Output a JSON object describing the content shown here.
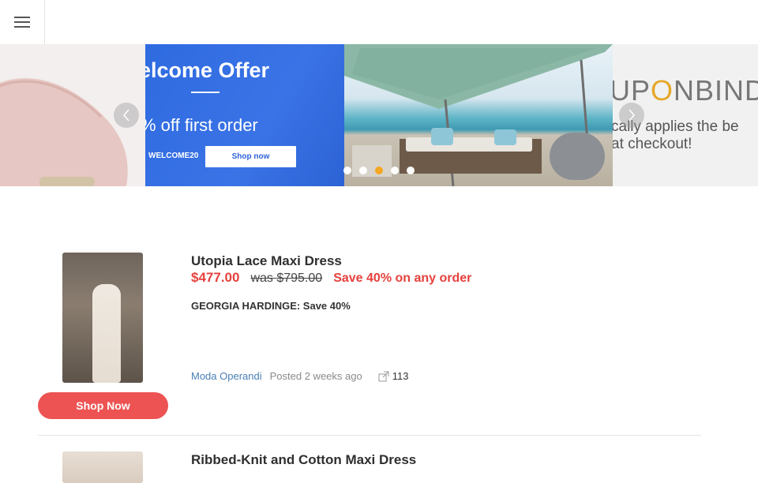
{
  "header": {
    "menu_icon": "hamburger-menu-icon"
  },
  "carousel": {
    "welcome": {
      "title": "elcome Offer",
      "subtitle": "% off first order",
      "code": "WELCOME20",
      "cta": "Shop now"
    },
    "coupon": {
      "logo_prefix": "UP",
      "logo_o": "O",
      "logo_suffix": "NBIND",
      "line1": "cally applies the be",
      "line2": "at checkout!"
    },
    "prev_icon": "chevron-left-icon",
    "next_icon": "chevron-right-icon",
    "dots": 5,
    "active_dot": 3,
    "accent": "#f5a623"
  },
  "deals": [
    {
      "title": "Utopia Lace Maxi Dress",
      "price": "$477.00",
      "was_label": "was",
      "was_price": "$795.00",
      "note": "Save 40% on any order",
      "description": "GEORGIA HARDINGE: Save 40%",
      "store": "Moda Operandi",
      "posted": "Posted 2 weeks ago",
      "shares": "113",
      "cta": "Shop Now"
    },
    {
      "title": "Ribbed-Knit and Cotton Maxi Dress"
    }
  ],
  "colors": {
    "sale_red": "#e5413d",
    "button_red": "#ed5353",
    "link_blue": "#4a7fb5"
  }
}
